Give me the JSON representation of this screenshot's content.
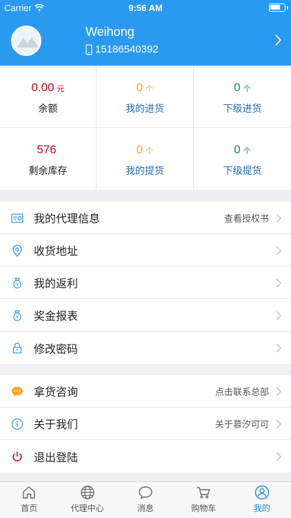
{
  "status_bar": {
    "carrier": "Carrier",
    "time": "9:56 AM"
  },
  "profile": {
    "name": "Weihong",
    "phone": "15186540392"
  },
  "stats": [
    {
      "value": "0.00",
      "unit": "元",
      "label": "余额",
      "value_color": "#d0021b",
      "label_color": "#222222"
    },
    {
      "value": "0",
      "unit": "个",
      "label": "我的进货",
      "value_color": "#f5a623",
      "label_color": "#1f6fb8"
    },
    {
      "value": "0",
      "unit": "个",
      "label": "下级进货",
      "value_color": "#128a6a",
      "label_color": "#1f6fb8"
    },
    {
      "value": "576",
      "unit": "",
      "label": "剩余库存",
      "value_color": "#d0021b",
      "label_color": "#222222"
    },
    {
      "value": "0",
      "unit": "个",
      "label": "我的提货",
      "value_color": "#f5a623",
      "label_color": "#1f6fb8"
    },
    {
      "value": "0",
      "unit": "个",
      "label": "下级提货",
      "value_color": "#128a6a",
      "label_color": "#1f6fb8"
    }
  ],
  "menu_group1": [
    {
      "label": "我的代理信息",
      "right": "查看授权书",
      "icon": "agent-card-icon"
    },
    {
      "label": "收货地址",
      "right": "",
      "icon": "location-pin-icon"
    },
    {
      "label": "我的返利",
      "right": "",
      "icon": "money-bag-icon"
    },
    {
      "label": "奖金报表",
      "right": "",
      "icon": "money-bag-icon"
    },
    {
      "label": "修改密码",
      "right": "",
      "icon": "lock-icon"
    }
  ],
  "menu_group2": [
    {
      "label": "拿货咨询",
      "right": "点击联系总部",
      "icon": "chat-bubble-icon"
    },
    {
      "label": "关于我们",
      "right": "关于慕汐可可",
      "icon": "info-icon"
    },
    {
      "label": "退出登陆",
      "right": "",
      "icon": "power-icon"
    }
  ],
  "tabs": [
    {
      "label": "首页",
      "icon": "home-icon",
      "active": false
    },
    {
      "label": "代理中心",
      "icon": "globe-icon",
      "active": false
    },
    {
      "label": "消息",
      "icon": "message-icon",
      "active": false
    },
    {
      "label": "购物车",
      "icon": "cart-icon",
      "active": false
    },
    {
      "label": "我的",
      "icon": "user-icon",
      "active": true
    }
  ],
  "colors": {
    "header_bg": "#2a9af0",
    "accent": "#1e88e5",
    "icon_blue": "#2a9af0"
  }
}
